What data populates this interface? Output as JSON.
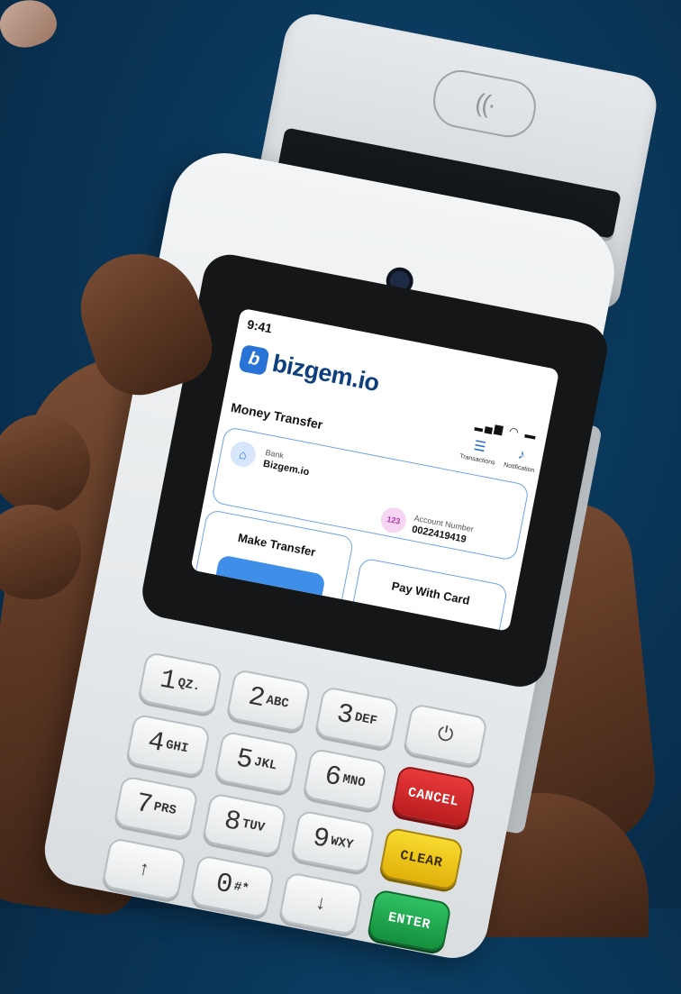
{
  "screen": {
    "status": {
      "time": "9:41",
      "icons": "▂▄▆ ◠ ▬"
    },
    "brand": {
      "logo_glyph": "b",
      "name": "bizgem.io"
    },
    "page_title": "Money Transfer",
    "actions": [
      {
        "label": "Transactions",
        "icon": "document-icon",
        "glyph": "☰"
      },
      {
        "label": "Notification",
        "icon": "bell-icon",
        "glyph": "♪"
      }
    ],
    "bank": {
      "icon": "bank-icon",
      "glyph": "⌂",
      "label": "Bank",
      "name": "Bizgem.io"
    },
    "account": {
      "badge": "123",
      "label": "Account Number",
      "number": "0022419419"
    },
    "panels": {
      "make_transfer": "Make Transfer",
      "pay_with_card": "Pay With Card"
    }
  },
  "hardware": {
    "nfc_glyph": "((∙",
    "keys": [
      {
        "num": "1",
        "sub": "QZ."
      },
      {
        "num": "2",
        "sub": "ABC"
      },
      {
        "num": "3",
        "sub": "DEF"
      },
      {
        "num": "4",
        "sub": "GHI"
      },
      {
        "num": "5",
        "sub": "JKL"
      },
      {
        "num": "6",
        "sub": "MNO"
      },
      {
        "num": "7",
        "sub": "PRS"
      },
      {
        "num": "8",
        "sub": "TUV"
      },
      {
        "num": "9",
        "sub": "WXY"
      },
      {
        "num": "0",
        "sub": "#*"
      }
    ],
    "function_keys": {
      "power": "⏻",
      "cancel": "CANCEL",
      "clear": "CLEAR",
      "enter": "ENTER",
      "up": "↑",
      "down": "↓"
    }
  },
  "colors": {
    "brand_blue": "#2a73d6",
    "accent_border": "#6fa3e6",
    "cancel_red": "#d32f2f",
    "clear_yellow": "#f2c318",
    "enter_green": "#1fa64d",
    "background": "#0a3658"
  }
}
